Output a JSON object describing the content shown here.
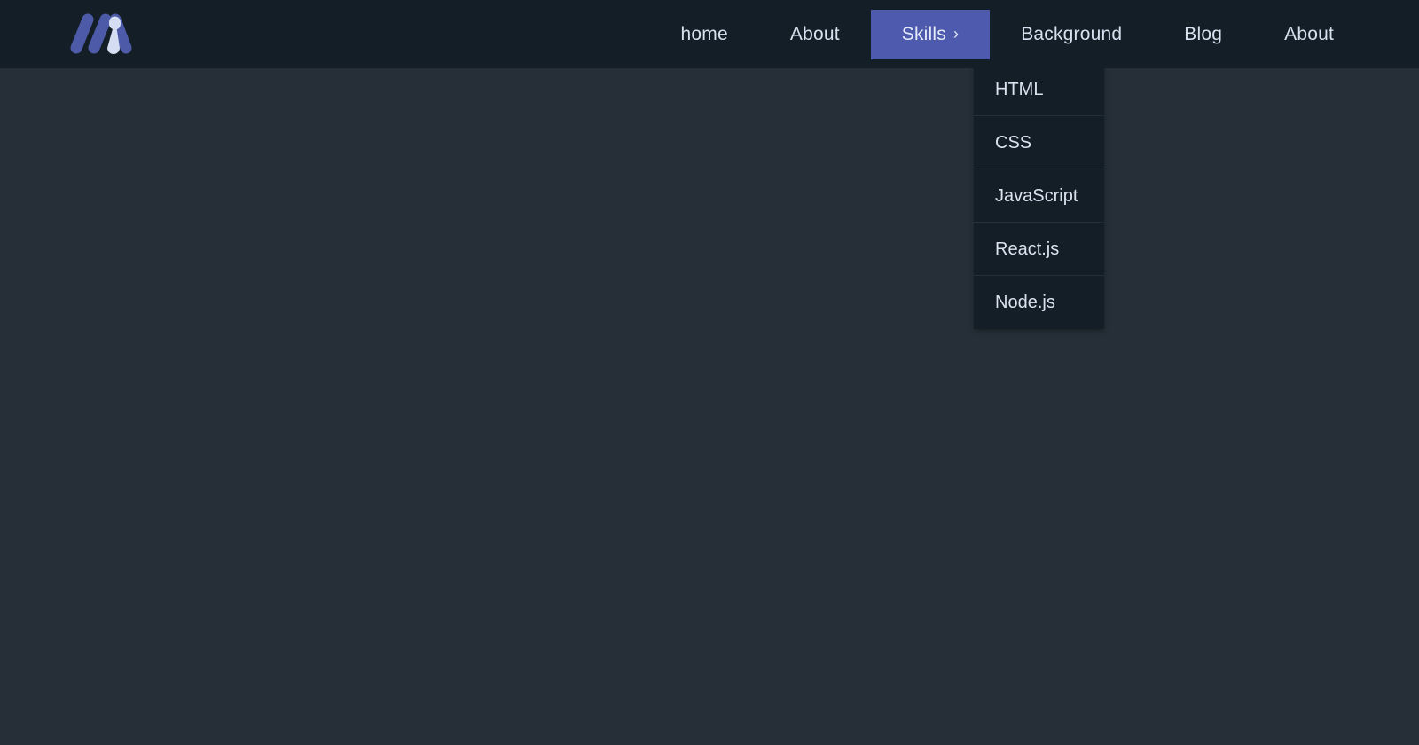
{
  "colors": {
    "header_bg": "#141e26",
    "body_bg": "#262f38",
    "accent": "#4d5aad",
    "nav_text": "#d6e0ef",
    "dropdown_bg": "#141e26",
    "dropdown_divider": "#233039",
    "logo_bar": "#4c5aa8",
    "logo_highlight": "#d5ddf2"
  },
  "header": {
    "logo": {
      "icon": "logo-mark-icon",
      "alt": "site logo"
    },
    "nav": {
      "items": [
        {
          "label": "home",
          "active": false,
          "has_caret": false
        },
        {
          "label": "About",
          "active": false,
          "has_caret": false
        },
        {
          "label": "Skills",
          "active": true,
          "has_caret": true,
          "caret": "›"
        },
        {
          "label": "Background",
          "active": false,
          "has_caret": false
        },
        {
          "label": "Blog",
          "active": false,
          "has_caret": false
        },
        {
          "label": "About",
          "active": false,
          "has_caret": false
        }
      ]
    }
  },
  "dropdown": {
    "owner": "Skills",
    "open": true,
    "items": [
      {
        "label": "HTML"
      },
      {
        "label": "CSS"
      },
      {
        "label": "JavaScript"
      },
      {
        "label": "React.js"
      },
      {
        "label": "Node.js"
      }
    ]
  },
  "main": {
    "content": ""
  }
}
